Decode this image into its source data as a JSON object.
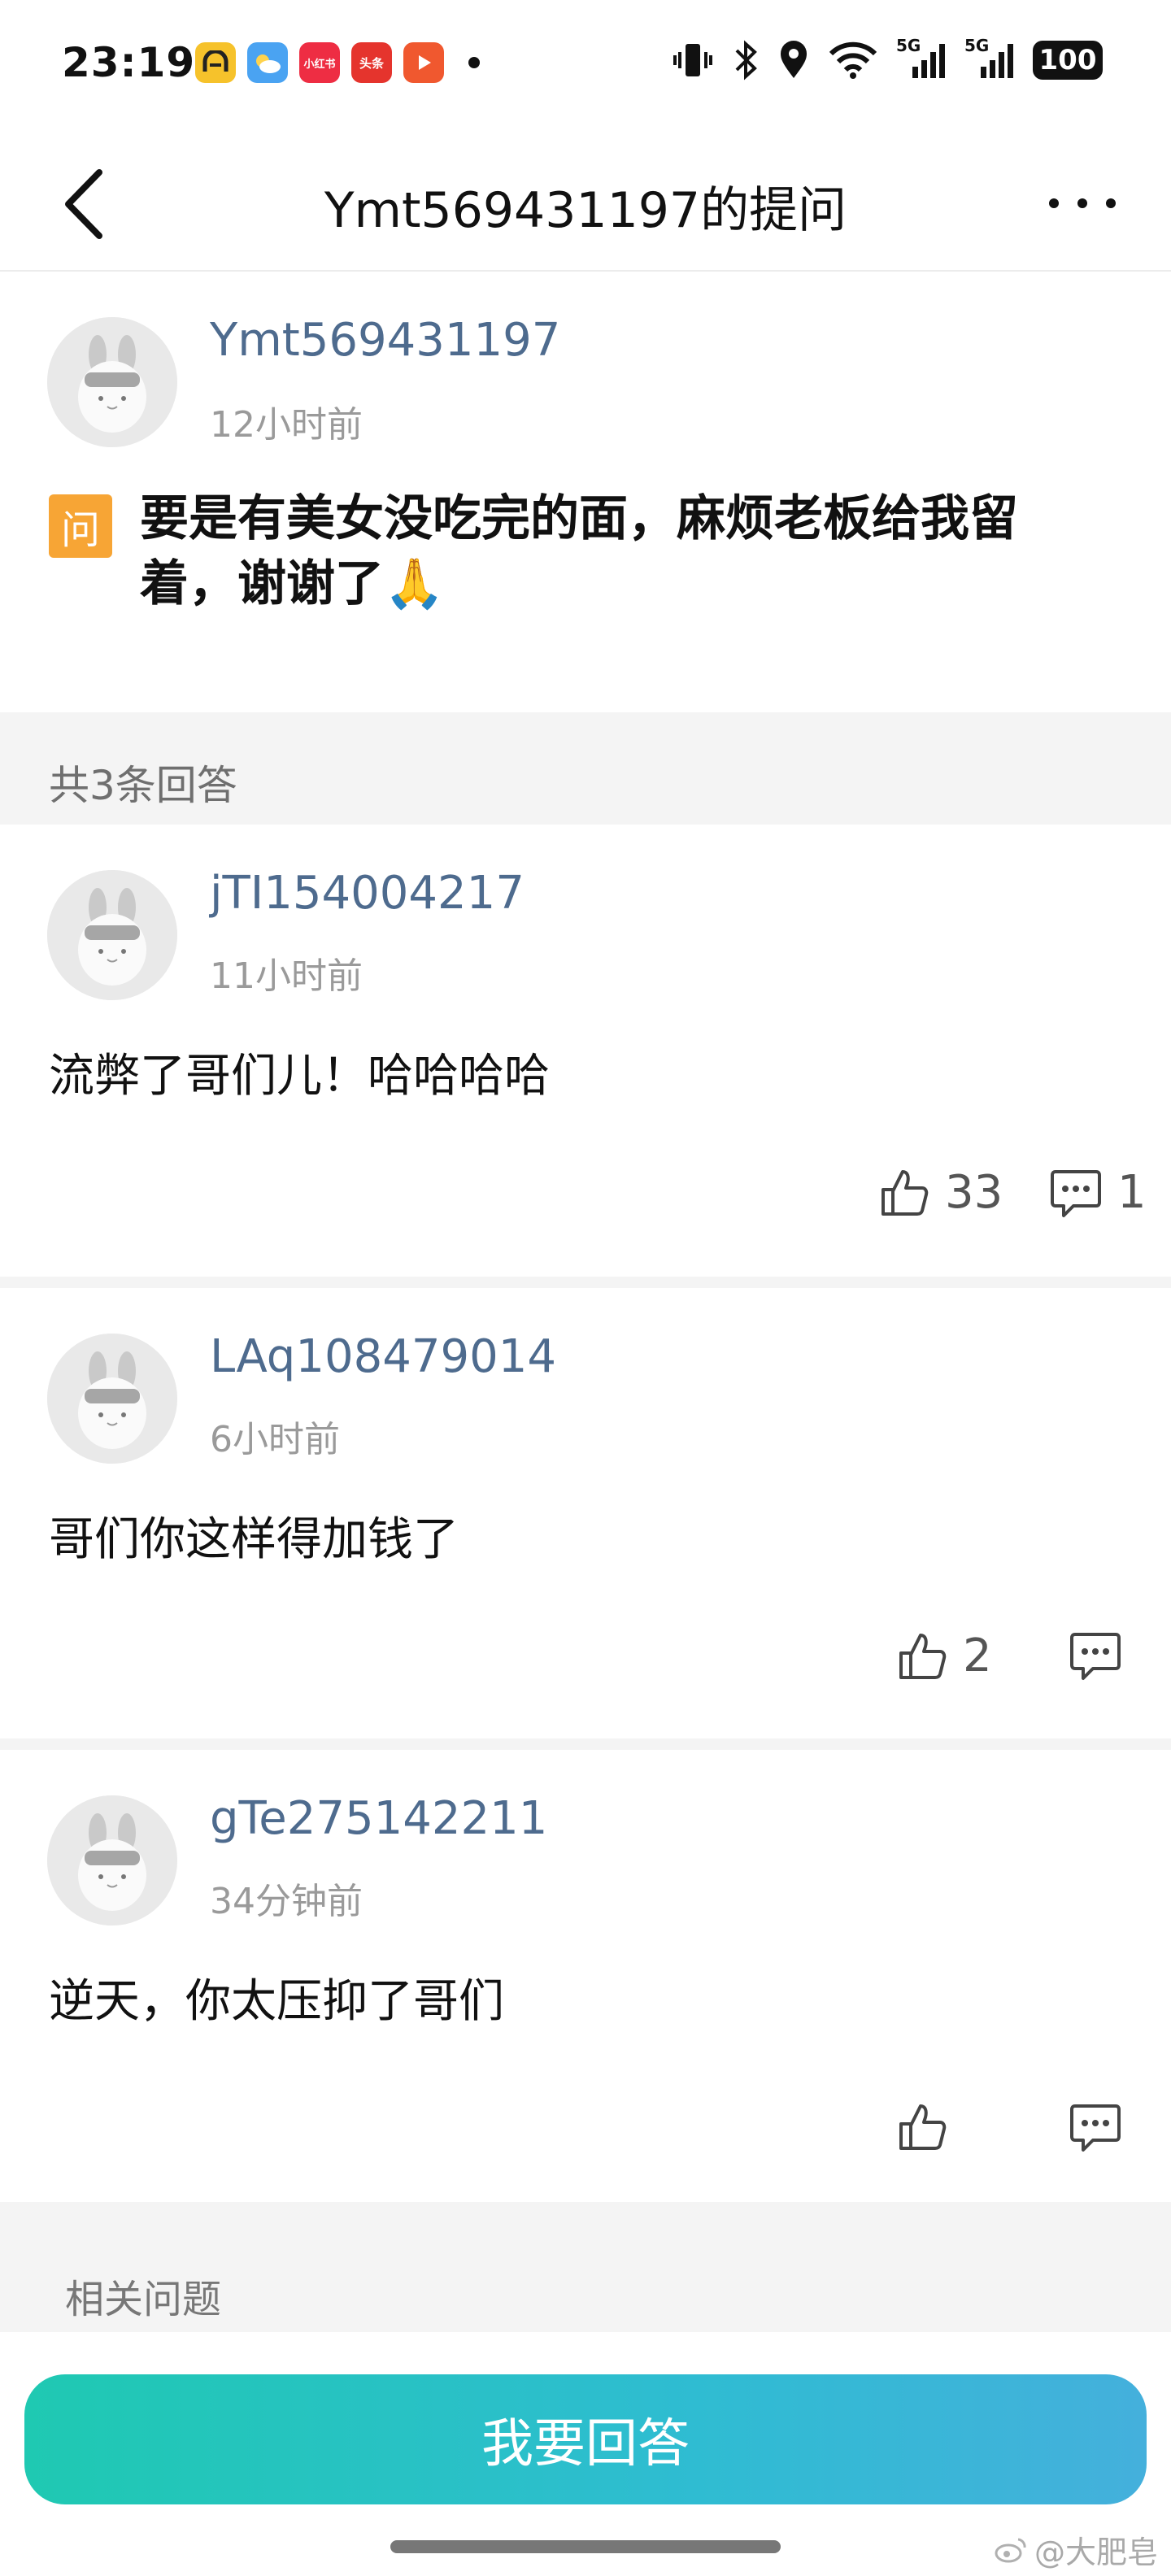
{
  "status_bar": {
    "time": "23:19",
    "apps": [
      {
        "name": "amap-app-icon",
        "label": "",
        "color": "#f6c22b"
      },
      {
        "name": "weather-app-icon",
        "label": "",
        "color": "#4aa3f2"
      },
      {
        "name": "xiaohongshu-app-icon",
        "label": "小红书",
        "color": "#ee2d43"
      },
      {
        "name": "toutiao-app-icon",
        "label": "头条",
        "color": "#e5342d"
      },
      {
        "name": "video-app-icon",
        "label": "",
        "color": "#f0582f"
      }
    ],
    "network_5g_1": "5G",
    "network_5g_2": "5G",
    "battery": "100"
  },
  "nav": {
    "title": "Ymt569431197的提问"
  },
  "question": {
    "username": "Ymt569431197",
    "time": "12小时前",
    "badge": "问",
    "text_line1": "要是有美女没吃完的面，麻烦老板给我留",
    "text_line2": "着，谢谢了🙏"
  },
  "answers_header": "共3条回答",
  "answers": [
    {
      "username": "jTI154004217",
      "time": "11小时前",
      "text": "流弊了哥们儿！哈哈哈哈",
      "likes": "33",
      "comments": "1"
    },
    {
      "username": "LAq108479014",
      "time": "6小时前",
      "text": "哥们你这样得加钱了",
      "likes": "2",
      "comments": ""
    },
    {
      "username": "gTe275142211",
      "time": "34分钟前",
      "text": "逆天，你太压抑了哥们",
      "likes": "",
      "comments": ""
    }
  ],
  "related_label": "相关问题",
  "answer_button": "我要回答",
  "watermark": "@大肥皂",
  "colors": {
    "username": "#4e6b8e",
    "badge": "#f7a535",
    "button_start": "#1fc9b2",
    "button_end": "#44b0dc"
  }
}
